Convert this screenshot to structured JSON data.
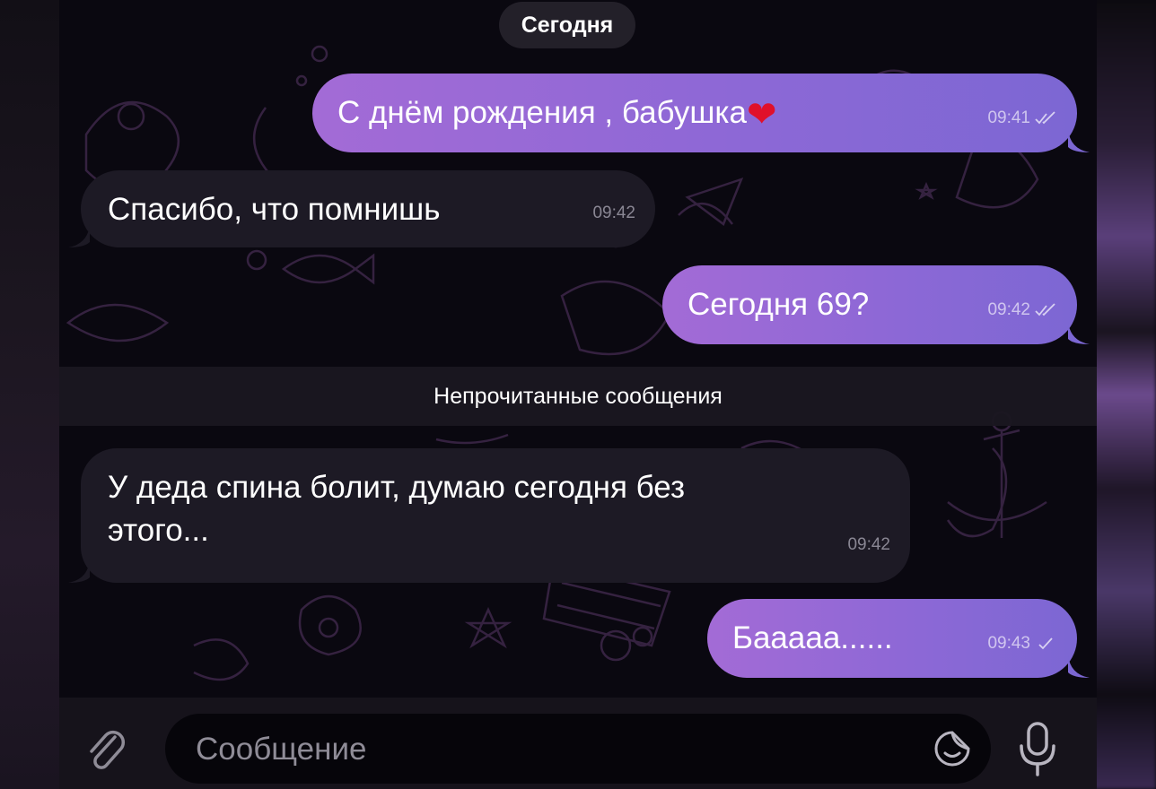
{
  "day_separator": "Сегодня",
  "messages": [
    {
      "direction": "outgoing",
      "text": "С днём рождения , бабушка",
      "emoji": "heart",
      "time": "09:41",
      "status": "read"
    },
    {
      "direction": "incoming",
      "text": "Спасибо, что помнишь",
      "time": "09:42"
    },
    {
      "direction": "outgoing",
      "text": "Сегодня 69?",
      "time": "09:42",
      "status": "read"
    },
    {
      "direction": "incoming",
      "text_line1": "У деда спина болит, думаю сегодня без",
      "text_line2": "этого...",
      "time": "09:42"
    },
    {
      "direction": "outgoing",
      "text": "Бааааа......",
      "time": "09:43",
      "status": "sent"
    }
  ],
  "unread_divider": "Непрочитанные сообщения",
  "composer": {
    "placeholder": "Сообщение",
    "attach_icon": "paperclip-icon",
    "sticker_icon": "sticker-icon",
    "mic_icon": "microphone-icon"
  },
  "colors": {
    "outgoing_bubble_start": "#a36bd6",
    "outgoing_bubble_end": "#7c67d3",
    "incoming_bubble": "#1d1a25",
    "background": "#0a0810",
    "heart": "#e0102a"
  }
}
